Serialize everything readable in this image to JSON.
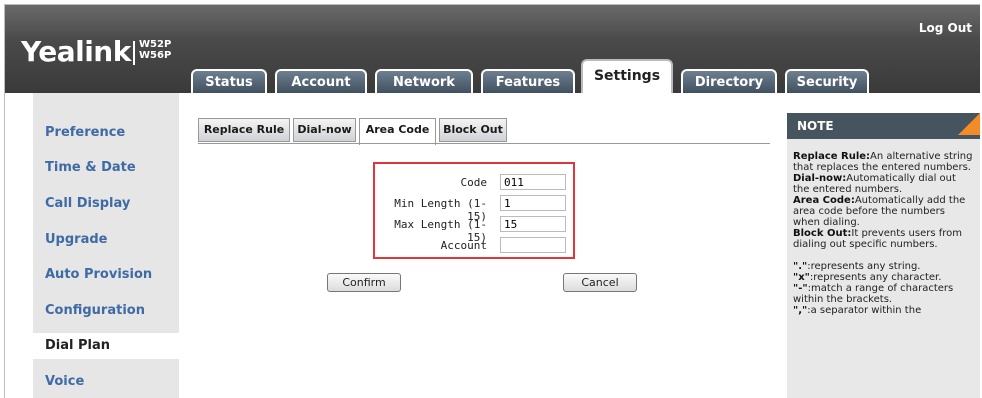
{
  "header": {
    "logo": "Yealink",
    "models": [
      "W52P",
      "W56P"
    ],
    "logout": "Log Out"
  },
  "tabs": [
    "Status",
    "Account",
    "Network",
    "Features",
    "Settings",
    "Directory",
    "Security"
  ],
  "active_tab": "Settings",
  "sidebar": {
    "items": [
      "Preference",
      "Time & Date",
      "Call Display",
      "Upgrade",
      "Auto Provision",
      "Configuration",
      "Dial Plan",
      "Voice"
    ],
    "active": "Dial Plan"
  },
  "subtabs": [
    "Replace Rule",
    "Dial-now",
    "Area Code",
    "Block Out"
  ],
  "active_subtab": "Area Code",
  "form": {
    "code_label": "Code",
    "code_value": "011",
    "min_label": "Min Length (1-15)",
    "min_value": "1",
    "max_label": "Max Length (1-15)",
    "max_value": "15",
    "account_label": "Account",
    "account_value": "",
    "confirm": "Confirm",
    "cancel": "Cancel"
  },
  "note": {
    "title": "NOTE",
    "replace_term": "Replace Rule:",
    "replace_text": "An alternative string that replaces the entered numbers.",
    "dialnow_term": "Dial-now:",
    "dialnow_text": "Automatically dial out the entered numbers.",
    "area_term": "Area Code:",
    "area_text": "Automatically add the area code before the numbers when dialing.",
    "block_term": "Block Out:",
    "block_text": "It prevents users from dialing out specific numbers.",
    "dot_term": "\".\"",
    "dot_text": ":represents any string.",
    "x_term": "\"x\"",
    "x_text": ":represents any character.",
    "dash_term": "\"-\"",
    "dash_text": ":match a range of characters within the brackets.",
    "comma_term": "\",\"",
    "comma_text": ":a separator within the"
  },
  "colors": {
    "highlight_border": "#e0353a",
    "note_corner": "#f28c28",
    "nav_link": "#3e6aa6"
  }
}
